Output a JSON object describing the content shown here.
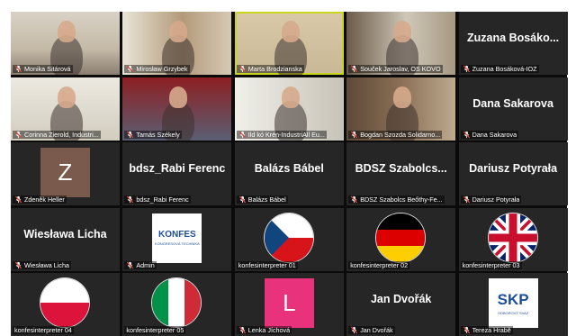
{
  "colors": {
    "background": "#0b0b0b",
    "tile": "#262626",
    "speaking_border": "#c8d61e",
    "muted_mic": "#e0483e"
  },
  "participants": [
    {
      "label": "Monika Sitárová",
      "kind": "video"
    },
    {
      "label": "Mirosław Grzybek",
      "kind": "video"
    },
    {
      "label": "Marta Brodzianska",
      "kind": "video",
      "speaking": true
    },
    {
      "label": "Souček Jaroslav, OS KOVO",
      "kind": "video"
    },
    {
      "label": "Zuzana Bosáková-IOZ",
      "display_name": "Zuzana Bosáko...",
      "kind": "name"
    },
    {
      "label": "Corinna Zierold, Industri...",
      "kind": "video"
    },
    {
      "label": "Tamás Székely",
      "kind": "video"
    },
    {
      "label": "Ild kó Krén-IndustriAll Eu...",
      "kind": "video"
    },
    {
      "label": "Bogdan Szozda Solidarno...",
      "kind": "video"
    },
    {
      "label": "Dana Sakarova",
      "display_name": "Dana Sakarova",
      "kind": "name"
    },
    {
      "label": "Zdeněk Heller",
      "kind": "avatar",
      "initial": "Z",
      "avatar_color": "#7a5a4c"
    },
    {
      "label": "bdsz_Rabi Ferenc",
      "display_name": "bdsz_Rabi Ferenc",
      "kind": "name"
    },
    {
      "label": "Balázs Bábel",
      "display_name": "Balázs Bábel",
      "kind": "name"
    },
    {
      "label": "BDSZ Szabolcs Beőthy-Fe...",
      "display_name": "BDSZ Szabolcs...",
      "kind": "name"
    },
    {
      "label": "Dariusz Potyrała",
      "display_name": "Dariusz Potyrała",
      "kind": "name"
    },
    {
      "label": "Wiesława Licha",
      "display_name": "Wiesława Licha",
      "kind": "name"
    },
    {
      "label": "Admin",
      "kind": "logo",
      "logo_text": "KONFES",
      "logo_sub": "KONGRESOVÁ TECHNIKA"
    },
    {
      "label": "konfesinterpreter 01",
      "kind": "flag",
      "flag": "cz",
      "no_mic": true
    },
    {
      "label": "konfesinterpreter 02",
      "kind": "flag",
      "flag": "de",
      "no_mic": true
    },
    {
      "label": "konfesinterpreter 03",
      "kind": "flag",
      "flag": "uk",
      "no_mic": true
    },
    {
      "label": "konfesinterpreter 04",
      "kind": "flag",
      "flag": "pl",
      "no_mic": true
    },
    {
      "label": "konfesinterpreter 05",
      "kind": "flag",
      "flag": "it",
      "no_mic": true
    },
    {
      "label": "Lenka Jíchová",
      "kind": "avatar",
      "initial": "L",
      "avatar_color": "#e8327c"
    },
    {
      "label": "Jan Dvořák",
      "display_name": "Jan Dvořák",
      "kind": "name"
    },
    {
      "label": "Tereza Hrabě",
      "kind": "logo",
      "logo_text": "SKP",
      "logo_sub": "ODBOROVÝ SVAZ"
    }
  ]
}
